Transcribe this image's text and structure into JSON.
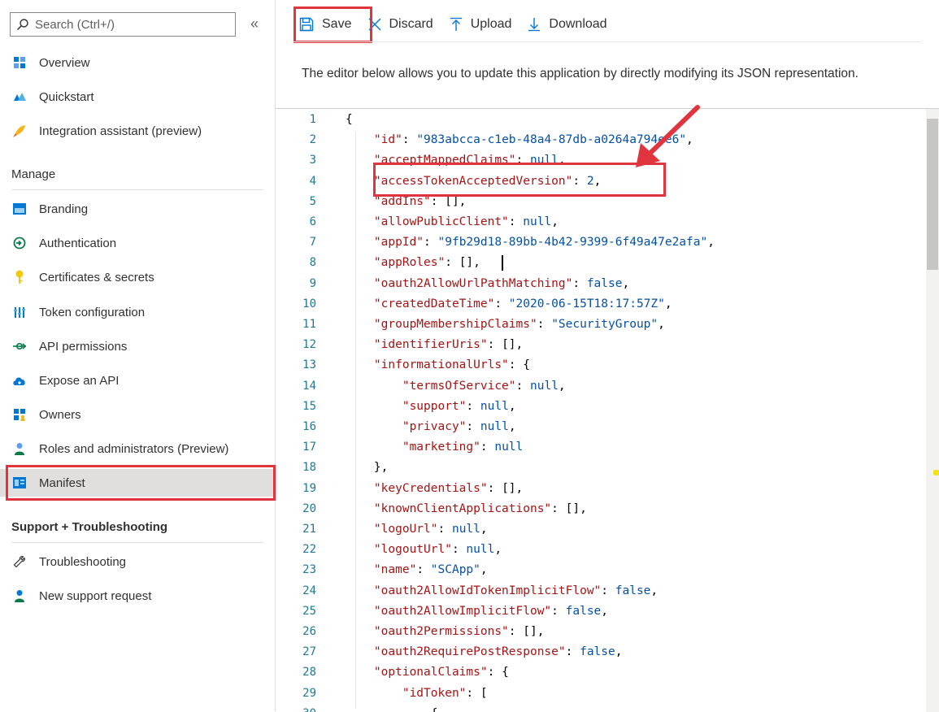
{
  "sidebar": {
    "search_placeholder": "Search (Ctrl+/)",
    "collapse_glyph": "«",
    "items": [
      {
        "label": "Overview",
        "icon": "overview-grid-icon",
        "color": "#0078d4"
      },
      {
        "label": "Quickstart",
        "icon": "quickstart-cloud-icon",
        "color": "#0078d4"
      },
      {
        "label": "Integration assistant (preview)",
        "icon": "rocket-icon",
        "color": "#f2b51b"
      }
    ],
    "manage_title": "Manage",
    "manage_items": [
      {
        "label": "Branding",
        "icon": "branding-icon"
      },
      {
        "label": "Authentication",
        "icon": "authentication-icon"
      },
      {
        "label": "Certificates & secrets",
        "icon": "key-icon"
      },
      {
        "label": "Token configuration",
        "icon": "token-bars-icon"
      },
      {
        "label": "API permissions",
        "icon": "api-permissions-icon"
      },
      {
        "label": "Expose an API",
        "icon": "cloud-api-icon"
      },
      {
        "label": "Owners",
        "icon": "owners-icon"
      },
      {
        "label": "Roles and administrators (Preview)",
        "icon": "roles-icon"
      },
      {
        "label": "Manifest",
        "icon": "manifest-icon",
        "selected": true
      }
    ],
    "support_title": "Support + Troubleshooting",
    "support_items": [
      {
        "label": "Troubleshooting",
        "icon": "wrench-icon"
      },
      {
        "label": "New support request",
        "icon": "support-person-icon"
      }
    ]
  },
  "toolbar": {
    "save": "Save",
    "discard": "Discard",
    "upload": "Upload",
    "download": "Download"
  },
  "description": "The editor below allows you to update this application by directly modifying its JSON representation.",
  "editor": {
    "line_numbers": [
      "1",
      "2",
      "3",
      "4",
      "5",
      "6",
      "7",
      "8",
      "9",
      "10",
      "11",
      "12",
      "13",
      "14",
      "15",
      "16",
      "17",
      "18",
      "19",
      "20",
      "21",
      "22",
      "23",
      "24",
      "25",
      "26",
      "27",
      "28",
      "29",
      "30"
    ],
    "lines": [
      "{",
      "    \"id\": \"983abcca-c1eb-48a4-87db-a0264a794ee6\",",
      "    \"acceptMappedClaims\": null,",
      "    \"accessTokenAcceptedVersion\": 2,",
      "    \"addIns\": [],",
      "    \"allowPublicClient\": null,",
      "    \"appId\": \"9fb29d18-89bb-4b42-9399-6f49a47e2afa\",",
      "    \"appRoles\": [],",
      "    \"oauth2AllowUrlPathMatching\": false,",
      "    \"createdDateTime\": \"2020-06-15T18:17:57Z\",",
      "    \"groupMembershipClaims\": \"SecurityGroup\",",
      "    \"identifierUris\": [],",
      "    \"informationalUrls\": {",
      "        \"termsOfService\": null,",
      "        \"support\": null,",
      "        \"privacy\": null,",
      "        \"marketing\": null",
      "    },",
      "    \"keyCredentials\": [],",
      "    \"knownClientApplications\": [],",
      "    \"logoUrl\": null,",
      "    \"logoutUrl\": null,",
      "    \"name\": \"SCApp\",",
      "    \"oauth2AllowIdTokenImplicitFlow\": false,",
      "    \"oauth2AllowImplicitFlow\": false,",
      "    \"oauth2Permissions\": [],",
      "    \"oauth2RequirePostResponse\": false,",
      "    \"optionalClaims\": {",
      "        \"idToken\": [",
      "            {"
    ]
  },
  "colors": {
    "highlight": "#e0353f",
    "json_key": "#a31515",
    "json_value": "#0451a5",
    "line_number": "#237893",
    "accent": "#0078d4"
  }
}
